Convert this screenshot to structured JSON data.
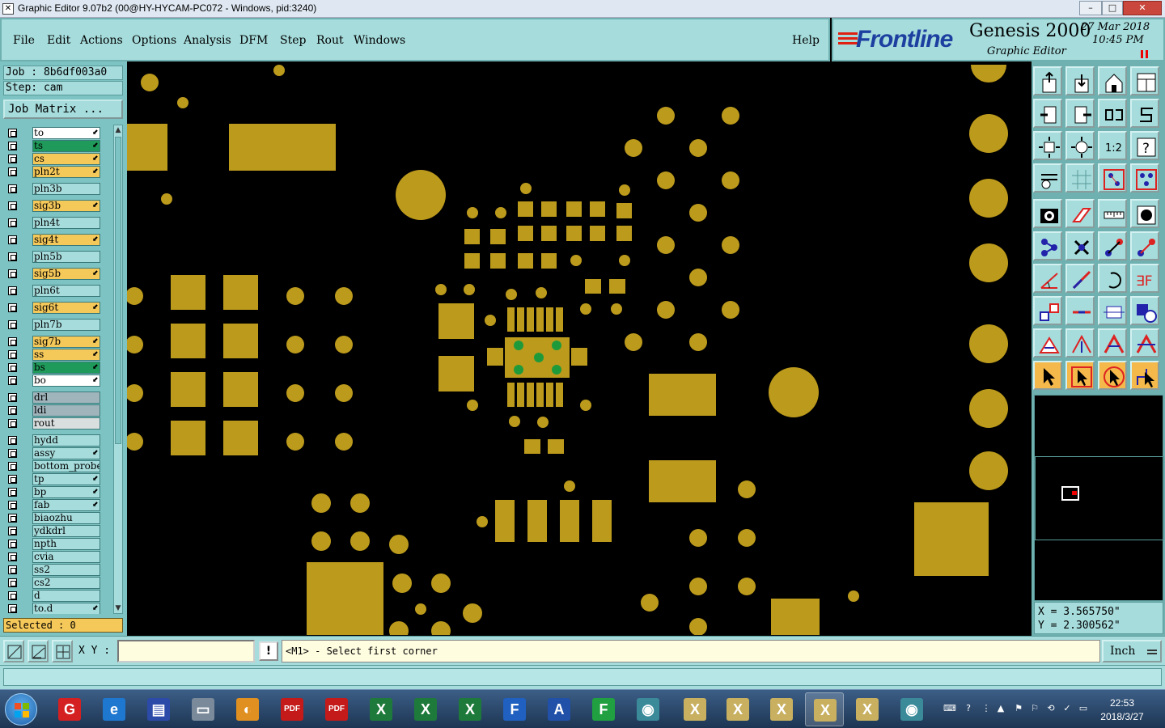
{
  "window": {
    "title": "Graphic Editor 9.07b2 (00@HY-HYCAM-PC072 - Windows, pid:3240)",
    "app_icon": "x-icon",
    "controls": [
      "–",
      "□",
      "✕"
    ]
  },
  "menu": {
    "items": [
      "File",
      "Edit",
      "Actions",
      "Options",
      "Analysis",
      "DFM",
      "Step",
      "Rout",
      "Windows"
    ],
    "help": "Help"
  },
  "brand": {
    "logo": "Frontline",
    "product": "Genesis 2000",
    "subtitle": "Graphic Editor",
    "date": "27 Mar 2018",
    "time": "10:45 PM"
  },
  "job": {
    "job_label": "Job : 8b6df003a0",
    "step_label": "Step: cam",
    "matrix_button": "Job Matrix ...",
    "selected": "Selected : 0"
  },
  "layers": [
    {
      "name": "to",
      "color": "#ffffff",
      "marker": "⬋"
    },
    {
      "name": "ts",
      "color": "#1f9a5a",
      "marker": "⬋"
    },
    {
      "name": "cs",
      "color": "#f5c85a",
      "marker": "⬋"
    },
    {
      "name": "pln2t",
      "color": "#f5c85a",
      "marker": "⬋"
    },
    {
      "name": "pln3b",
      "color": "#a6dcdc",
      "marker": ""
    },
    {
      "name": "sig3b",
      "color": "#f5c85a",
      "marker": "⬋"
    },
    {
      "name": "pln4t",
      "color": "#a6dcdc",
      "marker": ""
    },
    {
      "name": "sig4t",
      "color": "#f5c85a",
      "marker": "⬋"
    },
    {
      "name": "pln5b",
      "color": "#a6dcdc",
      "marker": ""
    },
    {
      "name": "sig5b",
      "color": "#f5c85a",
      "marker": "⬋"
    },
    {
      "name": "pln6t",
      "color": "#a6dcdc",
      "marker": ""
    },
    {
      "name": "sig6t",
      "color": "#f5c85a",
      "marker": "⬋"
    },
    {
      "name": "pln7b",
      "color": "#a6dcdc",
      "marker": ""
    },
    {
      "name": "sig7b",
      "color": "#f5c85a",
      "marker": "⬋"
    },
    {
      "name": "ss",
      "color": "#f5c85a",
      "marker": "⬋"
    },
    {
      "name": "bs",
      "color": "#1f9a5a",
      "marker": "⬋"
    },
    {
      "name": "bo",
      "color": "#ffffff",
      "marker": "⬋"
    },
    {
      "name": "drl",
      "color": "#a0b4bc",
      "marker": ""
    },
    {
      "name": "ldi",
      "color": "#a0b4bc",
      "marker": ""
    },
    {
      "name": "rout",
      "color": "#d9dede",
      "marker": ""
    },
    {
      "name": "hydd",
      "color": "#a6dcdc",
      "marker": ""
    },
    {
      "name": "assy",
      "color": "#a6dcdc",
      "marker": "⬋"
    },
    {
      "name": "bottom_probe",
      "color": "#a6dcdc",
      "marker": ""
    },
    {
      "name": "tp",
      "color": "#a6dcdc",
      "marker": "⬋"
    },
    {
      "name": "bp",
      "color": "#a6dcdc",
      "marker": "⬋"
    },
    {
      "name": "fab",
      "color": "#a6dcdc",
      "marker": "⬋"
    },
    {
      "name": "biaozhu",
      "color": "#a6dcdc",
      "marker": ""
    },
    {
      "name": "ydkdrl",
      "color": "#a6dcdc",
      "marker": ""
    },
    {
      "name": "npth",
      "color": "#a6dcdc",
      "marker": ""
    },
    {
      "name": "cvia",
      "color": "#a6dcdc",
      "marker": ""
    },
    {
      "name": "ss2",
      "color": "#a6dcdc",
      "marker": ""
    },
    {
      "name": "cs2",
      "color": "#a6dcdc",
      "marker": ""
    },
    {
      "name": "d",
      "color": "#a6dcdc",
      "marker": ""
    },
    {
      "name": "to.d",
      "color": "#a6dcdc",
      "marker": "⬋"
    }
  ],
  "colors": {
    "pad": "#bc9a1c",
    "ball": "#1f9a3a",
    "panel": "#a6dcdc",
    "canvas": "#000000"
  },
  "toolbox": {
    "rows": [
      [
        "export-icon",
        "import-icon",
        "home-icon",
        "window-icon"
      ],
      [
        "door-left-icon",
        "door-right-icon",
        "flip-icon",
        "s-shape-icon"
      ],
      [
        "zoom-fit-icon",
        "zoom-home-icon",
        "ratio-label",
        "help-icon"
      ],
      [
        "wrench-icon",
        "grid-icon",
        "layers-red-icon",
        "layers-red2-icon"
      ],
      [
        "camera-icon",
        "highlight-icon",
        "ruler-icon",
        "dot-icon"
      ],
      [
        "nodes-icon",
        "cross-icon",
        "connect-icon",
        "connect2-icon"
      ],
      [
        "angle-icon",
        "line-icon",
        "rotate-icon",
        "mirror-icon"
      ],
      [
        "box-move-icon",
        "minus-icon",
        "resize-icon",
        "shapes-icon"
      ],
      [
        "triangle-icon",
        "arrow-up-icon",
        "arrow-a-icon",
        "arrow-b-icon"
      ],
      [
        "pointer-icon",
        "pointer-box-icon",
        "pointer-circle-icon",
        "pointer-route-icon"
      ]
    ],
    "ratio_label": "1:2"
  },
  "coords": {
    "x": "X = 3.565750\"",
    "y": "Y = 2.300562\""
  },
  "command": {
    "xy_label": "X Y :",
    "xy_value": "",
    "excl": "!",
    "prompt": "<M1> - Select first corner",
    "units": "Inch"
  },
  "taskbar": {
    "apps": [
      {
        "name": "genesis-app-icon",
        "label": "G",
        "color": "#d42020"
      },
      {
        "name": "ie-icon",
        "label": "e",
        "color": "#1e78d0"
      },
      {
        "name": "save-disk-icon",
        "label": "▤",
        "color": "#2c4aa8"
      },
      {
        "name": "scanner-icon",
        "label": "▭",
        "color": "#7a8a9a"
      },
      {
        "name": "shell-icon",
        "label": "◐",
        "color": "#e09020"
      },
      {
        "name": "pdf-icon-1",
        "label": "PDF",
        "color": "#c41a1a"
      },
      {
        "name": "pdf-icon-2",
        "label": "PDF",
        "color": "#c41a1a"
      },
      {
        "name": "excel-icon-1",
        "label": "X",
        "color": "#1e7a3a"
      },
      {
        "name": "excel-icon-2",
        "label": "X",
        "color": "#1e7a3a"
      },
      {
        "name": "excel-icon-3",
        "label": "X",
        "color": "#1e7a3a"
      },
      {
        "name": "frontline-icon",
        "label": "F",
        "color": "#2060c0"
      },
      {
        "name": "word-icon",
        "label": "A",
        "color": "#2050a8"
      },
      {
        "name": "genesis-f-icon",
        "label": "F",
        "color": "#20a040"
      },
      {
        "name": "eye-icon",
        "label": "◉",
        "color": "#3a8a9a"
      },
      {
        "name": "xwin-icon-1",
        "label": "X",
        "color": "#c8b060"
      },
      {
        "name": "xwin-icon-2",
        "label": "X",
        "color": "#c8b060"
      },
      {
        "name": "xwin-icon-3",
        "label": "X",
        "color": "#c8b060"
      },
      {
        "name": "xwin-icon-4",
        "label": "X",
        "color": "#c8b060"
      },
      {
        "name": "xwin-icon-5",
        "label": "X",
        "color": "#c8b060"
      },
      {
        "name": "eye2-icon",
        "label": "◉",
        "color": "#3a8a9a"
      }
    ],
    "clock_time": "22:53",
    "clock_date": "2018/3/27"
  }
}
